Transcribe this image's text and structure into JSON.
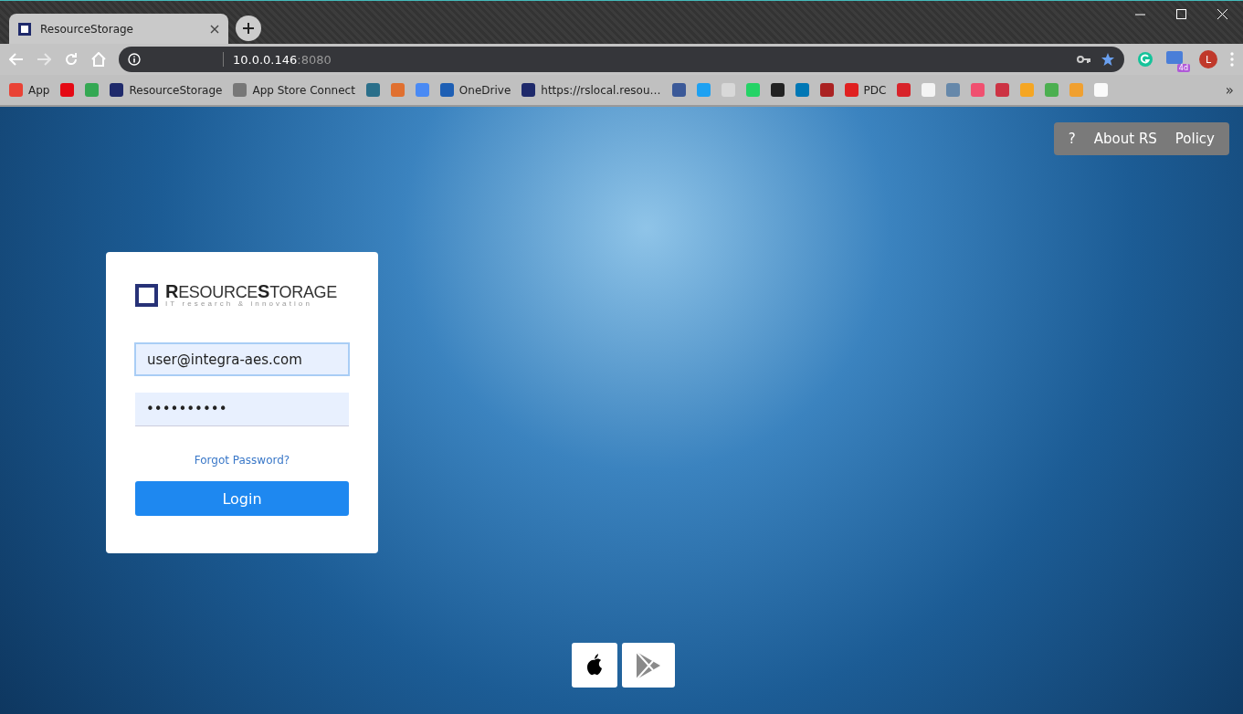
{
  "browser": {
    "tab": {
      "title": "ResourceStorage",
      "selected": true
    },
    "address": {
      "host": "10.0.0.146",
      "port": ":8080"
    },
    "profile_initial": "L",
    "extension_badge": "4d",
    "bookmarks": [
      {
        "label": "App",
        "color": "#e94235"
      },
      {
        "color": "#e50914"
      },
      {
        "color": "#34a853"
      },
      {
        "label": "ResourceStorage",
        "color": "#1f2a6b"
      },
      {
        "label": "App Store Connect",
        "color": "#777777"
      },
      {
        "color": "#2a6f8a"
      },
      {
        "color": "#e07030"
      },
      {
        "color": "#4a8af4"
      },
      {
        "label": "OneDrive",
        "color": "#1e5fb4"
      },
      {
        "label": "https://rslocal.resou…",
        "color": "#1f2a6b"
      },
      {
        "color": "#3b5998"
      },
      {
        "color": "#1da1f2"
      },
      {
        "color": "#d8d8d8"
      },
      {
        "color": "#25d366"
      },
      {
        "color": "#222222"
      },
      {
        "color": "#0077b5"
      },
      {
        "color": "#aa2222"
      },
      {
        "label": "PDC",
        "color": "#e02020"
      },
      {
        "color": "#d8232a"
      },
      {
        "color": "#f4f4f4"
      },
      {
        "color": "#6688aa"
      },
      {
        "color": "#f05070"
      },
      {
        "color": "#cc3344"
      },
      {
        "color": "#f5a623"
      },
      {
        "color": "#4caf50"
      },
      {
        "color": "#f0a030"
      },
      {
        "color": "#fafafa"
      }
    ],
    "bookmarks_more": "»"
  },
  "page": {
    "nav": [
      "?",
      "About RS",
      "Policy"
    ],
    "logo": {
      "name": "**R**ESOURCE**S**TORAGE",
      "tagline": "IT research & innovation"
    },
    "fields": [
      {
        "value": "user@integra-aes.com",
        "focused": true
      },
      {
        "value": "••••••••••",
        "focused": false
      }
    ],
    "forgot_link": "Forgot Password?",
    "login_button": "Login"
  }
}
